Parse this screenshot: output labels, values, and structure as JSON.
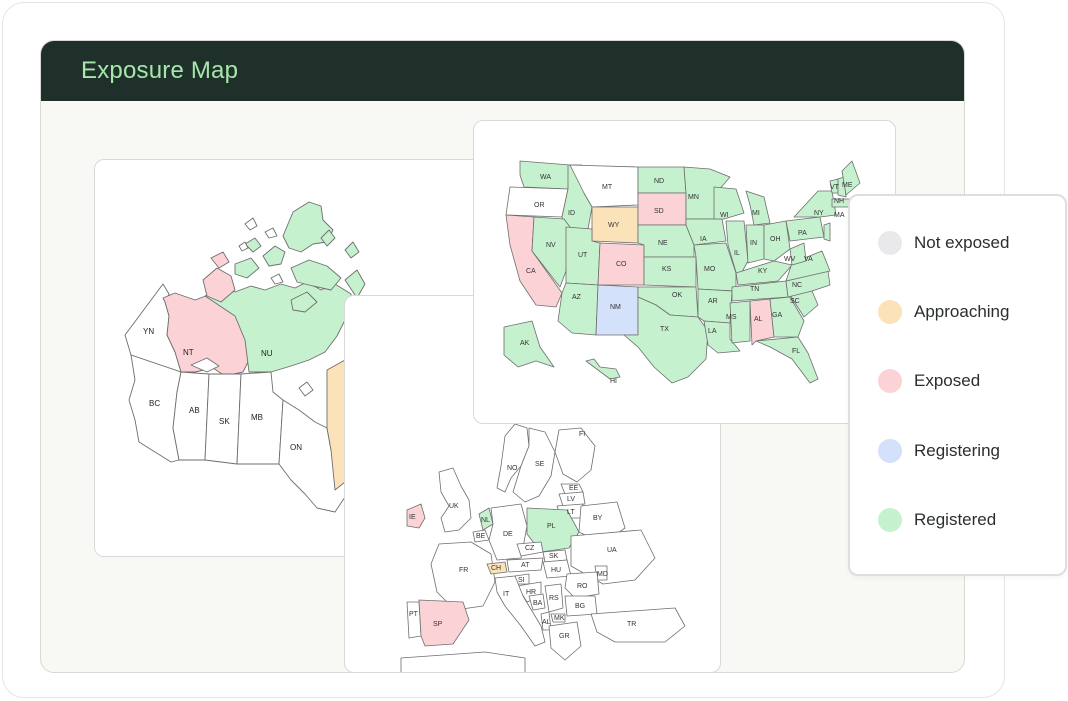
{
  "header": {
    "title": "Exposure Map"
  },
  "colors": {
    "not_exposed": "#e6e6ea",
    "approaching": "#fbe2b9",
    "exposed": "#fbd3d6",
    "registering": "#d4e1fa",
    "registered": "#c5f1cf",
    "border": "#6e6e6e"
  },
  "legend": [
    {
      "label": "Not exposed",
      "color": "#e9e9ec"
    },
    {
      "label": "Approaching",
      "color": "#fbe2b9"
    },
    {
      "label": "Exposed",
      "color": "#fbd3d6"
    },
    {
      "label": "Registering",
      "color": "#d4e1fa"
    },
    {
      "label": "Registered",
      "color": "#c5f1cf"
    }
  ],
  "canada": {
    "labels": [
      "YN",
      "NT",
      "NU",
      "BC",
      "AB",
      "SK",
      "MB",
      "ON"
    ],
    "status": {
      "NT": "exposed",
      "NU": "registered",
      "QC": "approaching"
    }
  },
  "usa": {
    "labels": [
      "WA",
      "MT",
      "ND",
      "MN",
      "OR",
      "ID",
      "WY",
      "SD",
      "WI",
      "MI",
      "NE",
      "IA",
      "NV",
      "UT",
      "CO",
      "KS",
      "MO",
      "IL",
      "IN",
      "OH",
      "PA",
      "NY",
      "VT",
      "NH",
      "ME",
      "MA",
      "CA",
      "AZ",
      "NM",
      "OK",
      "AR",
      "KY",
      "WV",
      "VA",
      "TN",
      "NC",
      "SC",
      "TX",
      "LA",
      "MS",
      "AL",
      "GA",
      "FL",
      "AK",
      "HI"
    ],
    "status": {
      "WY": "approaching",
      "SD": "exposed",
      "CO": "exposed",
      "CA": "exposed",
      "AL": "exposed",
      "NM": "registering",
      "MT": "not_exposed",
      "OR": "not_exposed"
    }
  },
  "europe": {
    "labels": [
      "FI",
      "SE",
      "NO",
      "EE",
      "LV",
      "LT",
      "BY",
      "PL",
      "DE",
      "NL",
      "BE",
      "IE",
      "UK",
      "FR",
      "CH",
      "CZ",
      "SK",
      "AT",
      "HU",
      "RO",
      "MD",
      "UA",
      "SI",
      "HR",
      "BA",
      "RS",
      "BG",
      "MK",
      "AL",
      "GR",
      "IT",
      "ES",
      "PT",
      "TR"
    ],
    "status": {
      "IE": "exposed",
      "ES": "exposed",
      "NL": "registered",
      "PL": "registered",
      "CH": "approaching"
    }
  }
}
